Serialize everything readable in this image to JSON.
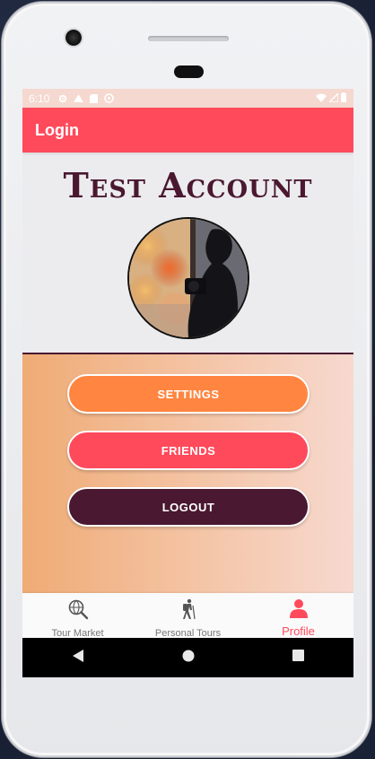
{
  "status_bar": {
    "time": "6:10",
    "left_icons": [
      "gear-icon",
      "drive-icon",
      "sd-card-icon",
      "sync-icon"
    ],
    "right_icons": [
      "wifi-icon",
      "signal-icon",
      "battery-icon"
    ]
  },
  "app_bar": {
    "title": "Login"
  },
  "profile": {
    "account_name": "Test Account",
    "avatar": "profile-photo-silhouette"
  },
  "actions": {
    "settings_label": "SETTINGS",
    "friends_label": "FRIENDS",
    "logout_label": "LOGOUT"
  },
  "bottom_nav": {
    "items": [
      {
        "label": "Tour Market",
        "icon": "globe-search-icon",
        "active": false
      },
      {
        "label": "Personal Tours",
        "icon": "hiker-icon",
        "active": false
      },
      {
        "label": "Profile",
        "icon": "person-icon",
        "active": true
      }
    ]
  },
  "system_nav": [
    "back-icon",
    "home-icon",
    "recents-icon"
  ],
  "colors": {
    "accent": "#ff4a5c",
    "settings": "#ff8540",
    "logout": "#4a1830",
    "title_text": "#4a1830"
  }
}
